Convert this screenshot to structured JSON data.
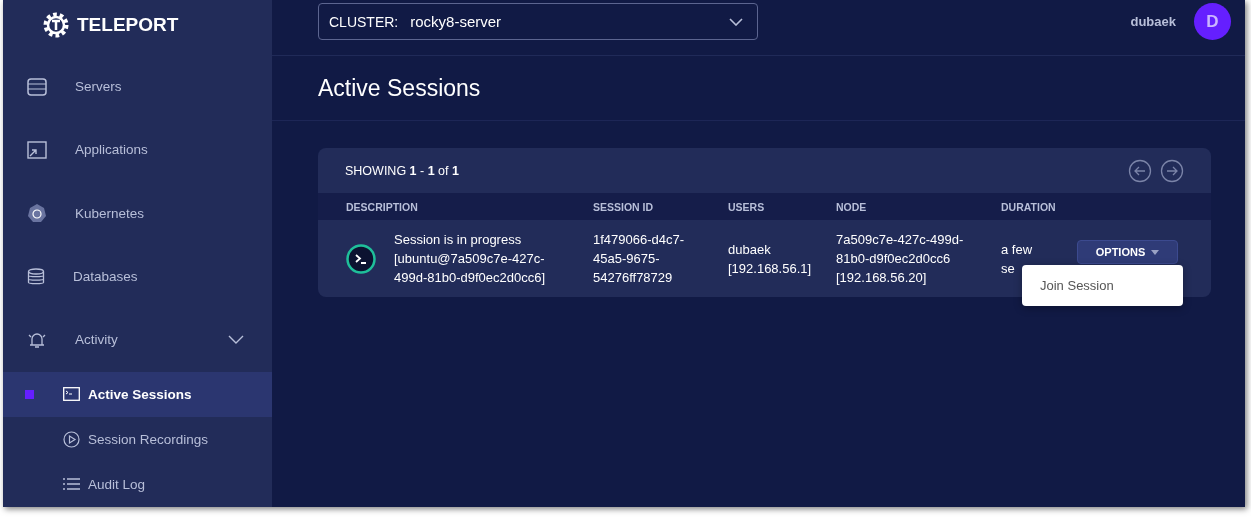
{
  "brand": {
    "name": "TELEPORT"
  },
  "sidebar": {
    "items": [
      {
        "label": "Servers",
        "kind": "server",
        "selected": false
      },
      {
        "label": "Applications",
        "kind": "app",
        "selected": false
      },
      {
        "label": "Kubernetes",
        "kind": "kube",
        "selected": false
      },
      {
        "label": "Databases",
        "kind": "db",
        "selected": false
      },
      {
        "label": "Activity",
        "kind": "bell",
        "selected": false,
        "expanded": true,
        "children": [
          {
            "label": "Active Sessions",
            "kind": "terminal",
            "selected": true
          },
          {
            "label": "Session Recordings",
            "kind": "play",
            "selected": false
          },
          {
            "label": "Audit Log",
            "kind": "list",
            "selected": false
          }
        ]
      }
    ]
  },
  "topbar": {
    "cluster_label": "CLUSTER:",
    "cluster_value": "rocky8-server",
    "user": "dubaek",
    "avatar": "D"
  },
  "page": {
    "title": "Active Sessions"
  },
  "table": {
    "showing": "SHOWING **1** - **1** of **1**",
    "columns": [
      "DESCRIPTION",
      "SESSION ID",
      "USERS",
      "NODE",
      "DURATION"
    ],
    "rows": [
      {
        "description": "Session is in progress [ubuntu@7a509c7e-427c-499d-81b0-d9f0ec2d0cc6]",
        "session_id": "1f479066-d4c7-45a5-9675-54276ff78729",
        "users": "dubaek [192.168.56.1]",
        "node": "7a509c7e-427c-499d-81b0-d9f0ec2d0cc6 [192.168.56.20]",
        "duration": "a few se",
        "action": "OPTIONS"
      }
    ]
  },
  "menu": {
    "items": [
      "Join Session"
    ]
  }
}
